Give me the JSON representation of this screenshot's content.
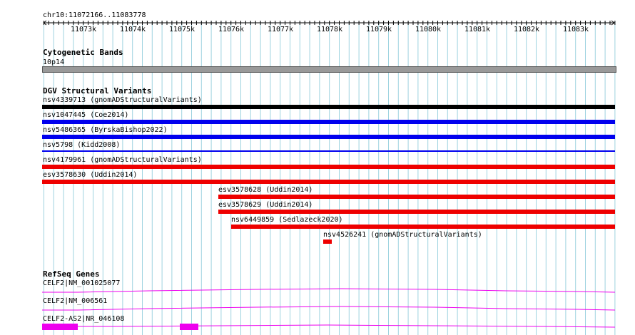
{
  "ruler": {
    "location": "chr10:11072166..11083778",
    "ticks": [
      "11073k",
      "11074k",
      "11075k",
      "11076k",
      "11077k",
      "11078k",
      "11079k",
      "11080k",
      "11081k",
      "11082k",
      "11083k"
    ]
  },
  "cytobands": {
    "title": "Cytogenetic Bands",
    "band": "10p14"
  },
  "dgv": {
    "title": "DGV Structural Variants",
    "features": [
      {
        "label": "nsv4339713 (gnomADStructuralVariants)",
        "color": "#000000"
      },
      {
        "label": "nsv1047445 (Coe2014)",
        "color": "#0000ee"
      },
      {
        "label": "nsv5486365 (ByrskaBishop2022)",
        "color": "#0000ee"
      },
      {
        "label": "nsv5798 (Kidd2008)",
        "color": "#0000ee"
      },
      {
        "label": "nsv4179961 (gnomADStructuralVariants)",
        "color": "#ee0000"
      },
      {
        "label": "esv3578630 (Uddin2014)",
        "color": "#ee0000"
      },
      {
        "label": "esv3578628 (Uddin2014)",
        "color": "#ee0000"
      },
      {
        "label": "esv3578629 (Uddin2014)",
        "color": "#ee0000"
      },
      {
        "label": "nsv6449859 (Sedlazeck2020)",
        "color": "#ee0000"
      },
      {
        "label": "nsv4526241 (gnomADStructuralVariants)",
        "color": "#ee0000"
      }
    ]
  },
  "refseq": {
    "title": "RefSeq Genes",
    "genes": [
      {
        "label": "CELF2|NM_001025077"
      },
      {
        "label": "CELF2|NM_006561"
      },
      {
        "label": "CELF2-AS2|NR_046108"
      }
    ],
    "color": "#ee00ee"
  },
  "colors": {
    "grid": "#9ed3e0",
    "band": "#999999"
  }
}
